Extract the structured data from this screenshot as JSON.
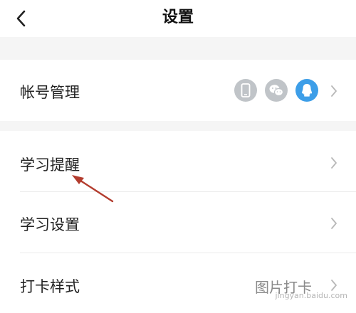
{
  "header": {
    "title": "设置",
    "back_icon": "back-chevron-icon"
  },
  "rows": {
    "account": {
      "label": "帐号管理",
      "icons": [
        "phone-icon",
        "wechat-icon",
        "qq-icon"
      ],
      "icon_colors": {
        "phone": "#c0c4c8",
        "wechat": "#c0c4c8",
        "qq": "#3d9ee8"
      }
    },
    "study_reminder": {
      "label": "学习提醒"
    },
    "study_settings": {
      "label": "学习设置"
    },
    "checkin_style": {
      "label": "打卡样式",
      "value": "图片打卡"
    }
  },
  "annotation": {
    "arrow_color": "#b33c2e"
  },
  "watermark": {
    "text": "jingyan.baidu.com"
  }
}
